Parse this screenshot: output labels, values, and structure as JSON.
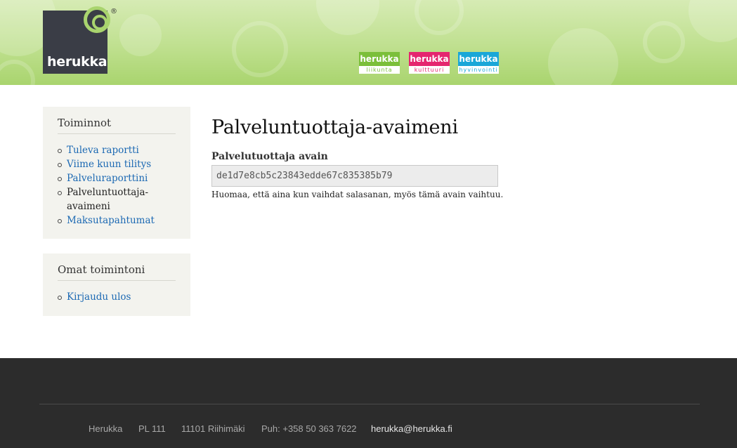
{
  "brand": {
    "logo_text": "herukka",
    "registered": "®",
    "sub_brands": [
      {
        "name": "herukka",
        "tag": "liikunta",
        "color": "#7bbf3a"
      },
      {
        "name": "herukka",
        "tag": "kulttuuri",
        "color": "#e5266f"
      },
      {
        "name": "herukka",
        "tag": "hyvinvointi",
        "color": "#1aa7d8"
      }
    ]
  },
  "sidebar": {
    "actions": {
      "title": "Toiminnot",
      "items": [
        {
          "label": "Tuleva raportti",
          "active": false
        },
        {
          "label": "Viime kuun tilitys",
          "active": false
        },
        {
          "label": "Palveluraporttini",
          "active": false
        },
        {
          "label": "Palveluntuottaja-avaimeni",
          "active": true
        },
        {
          "label": "Maksutapahtumat",
          "active": false
        }
      ]
    },
    "own_actions": {
      "title": "Omat toimintoni",
      "items": [
        {
          "label": "Kirjaudu ulos",
          "active": false
        }
      ]
    }
  },
  "main": {
    "title": "Palveluntuottaja-avaimeni",
    "key_label": "Palvelutuottaja avain",
    "key_value": "de1d7e8cb5c23843edde67c835385b79",
    "note": "Huomaa, että aina kun vaihdat salasanan, myös tämä avain vaihtuu."
  },
  "footer": {
    "company": "Herukka",
    "po_box": "PL 111",
    "city": "11101 Riihimäki",
    "phone": "Puh: +358 50 363 7622",
    "email": "herukka@herukka.fi"
  },
  "colors": {
    "header_green": "#a9d46e",
    "link_blue": "#1c69b3",
    "footer_bg": "#2c2c2c",
    "sidebar_bg": "#f3f3ee"
  }
}
